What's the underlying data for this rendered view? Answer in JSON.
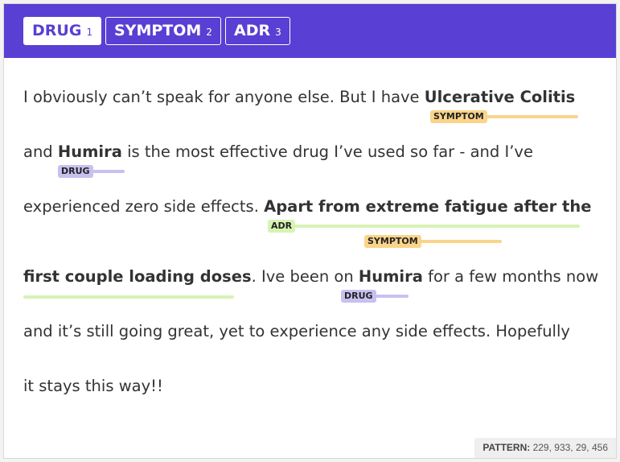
{
  "tabs": [
    {
      "label": "DRUG",
      "key": "1",
      "active": true
    },
    {
      "label": "SYMPTOM",
      "key": "2",
      "active": false
    },
    {
      "label": "ADR",
      "key": "3",
      "active": false
    }
  ],
  "text": {
    "l1a": "I obviously can’t speak for anyone else. But I have ",
    "l1b": "Ulcerative Colitis",
    "l2a": "and ",
    "l2b": "Humira",
    "l2c": " is the most effective drug I’ve used so far - and I’ve",
    "l3a": "experienced zero side effects. ",
    "l3b": "Apart from extreme fatigue after the",
    "l4a": "first couple loading doses",
    "l4b": ". Ive been on ",
    "l4c": "Humira",
    "l4d": " for a few months now",
    "l5": "and it’s still going great, yet to experience any side effects. Hopefully",
    "l6": "it stays this way!!"
  },
  "annotations": {
    "symptom1": "SYMPTOM",
    "drug1": "DRUG",
    "adr1": "ADR",
    "symptom2": "SYMPTOM",
    "drug2": "DRUG"
  },
  "colors": {
    "header": "#5a3fd4",
    "drug": "#c9c0f0",
    "symptom": "#f9d48a",
    "adr": "#d7f3b4"
  },
  "pattern": {
    "label": "PATTERN:",
    "value": "229, 933, 29, 456"
  }
}
